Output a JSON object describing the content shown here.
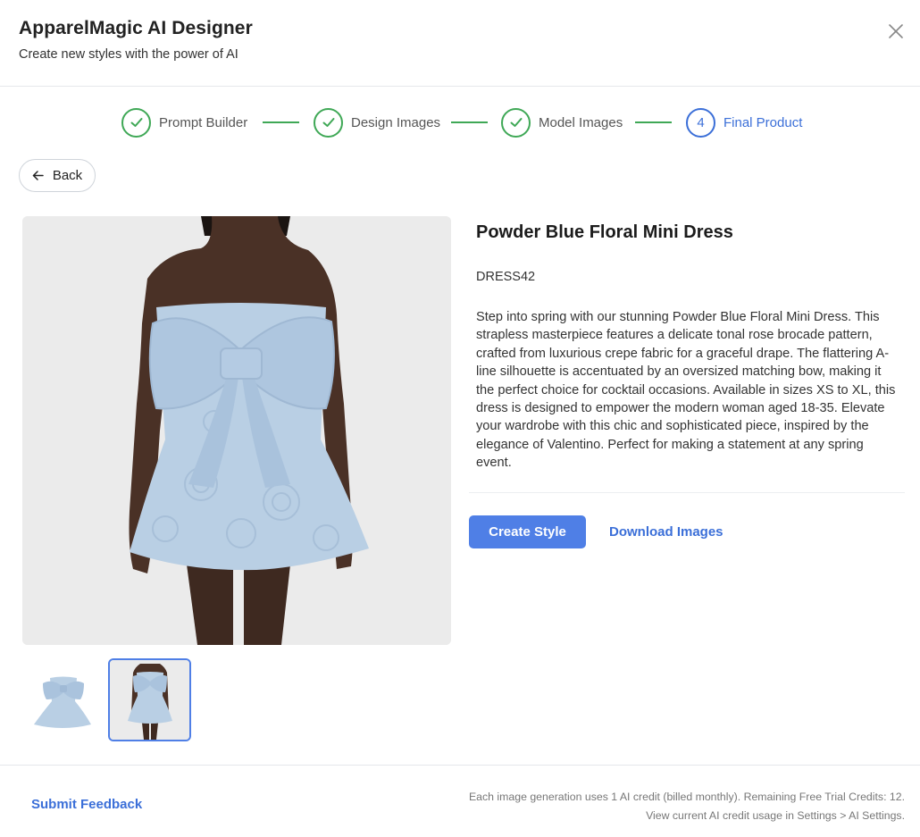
{
  "header": {
    "title": "ApparelMagic AI Designer",
    "subtitle": "Create new styles with the power of AI"
  },
  "stepper": {
    "steps": [
      {
        "label": "Prompt Builder",
        "state": "complete"
      },
      {
        "label": "Design Images",
        "state": "complete"
      },
      {
        "label": "Model Images",
        "state": "complete"
      },
      {
        "label": "Final Product",
        "state": "active",
        "number": "4"
      }
    ]
  },
  "back_button": {
    "label": "Back"
  },
  "product": {
    "title": "Powder Blue Floral Mini Dress",
    "sku": "DRESS42",
    "description": "Step into spring with our stunning Powder Blue Floral Mini Dress. This strapless masterpiece features a delicate tonal rose brocade pattern, crafted from luxurious crepe fabric for a graceful drape. The flattering A-line silhouette is accentuated by an oversized matching bow, making it the perfect choice for cocktail occasions. Available in sizes XS to XL, this dress is designed to empower the modern woman aged 18-35. Elevate your wardrobe with this chic and sophisticated piece, inspired by the elegance of Valentino. Perfect for making a statement at any spring event."
  },
  "actions": {
    "create_label": "Create Style",
    "download_label": "Download Images"
  },
  "footer": {
    "feedback_label": "Submit Feedback",
    "credit_line1": "Each image generation uses 1 AI credit (billed monthly). Remaining Free Trial Credits: 12.",
    "credit_line2": "View current AI credit usage in Settings > AI Settings."
  },
  "colors": {
    "accent": "#4f7fe6",
    "link": "#3b6fd8",
    "step_complete": "#3fa856",
    "dress": "#b9cfe4"
  },
  "icons": {
    "close": "close-icon",
    "check": "check-icon",
    "back": "arrow-left-icon"
  },
  "thumbnails": [
    {
      "name": "dress-flat-thumbnail",
      "selected": false
    },
    {
      "name": "model-thumbnail",
      "selected": true
    }
  ]
}
